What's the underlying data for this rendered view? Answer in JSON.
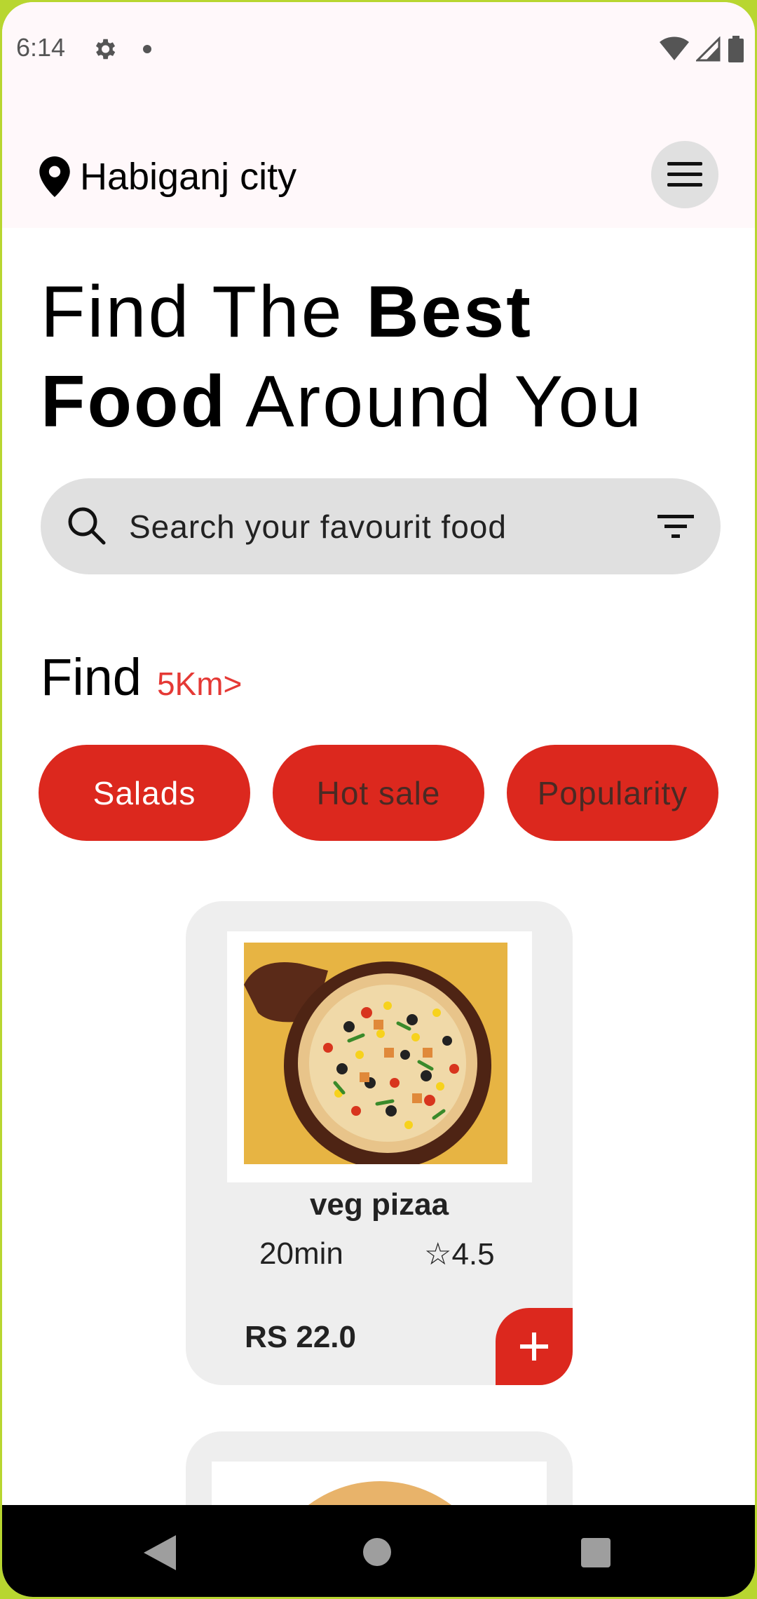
{
  "status_bar": {
    "time": "6:14",
    "icons": [
      "gear-icon",
      "dot-icon",
      "wifi-icon",
      "signal-icon",
      "battery-icon"
    ]
  },
  "header": {
    "location": "Habiganj city",
    "location_icon": "pin-icon",
    "menu_icon": "hamburger-menu-icon"
  },
  "headline": {
    "part1": "Find The ",
    "part2_bold": "Best",
    "part3_bold": "Food",
    "part4": " Around You"
  },
  "search": {
    "placeholder": "Search your favourit food",
    "search_icon": "search-icon",
    "filter_icon": "filter-icon"
  },
  "find": {
    "title": "Find",
    "distance": "5Km>"
  },
  "categories": [
    {
      "label": "Salads",
      "text_color": "#ffffff"
    },
    {
      "label": "Hot sale",
      "text_color": "#4a2a24"
    },
    {
      "label": "Popularity",
      "text_color": "#4a2a24"
    }
  ],
  "food_items": [
    {
      "name": "veg pizaa",
      "time": "20min",
      "rating": "☆4.5",
      "price": "RS 22.0",
      "image": "pizza-image"
    }
  ],
  "nav_bar": {
    "buttons": [
      "back-icon",
      "home-icon",
      "recents-icon"
    ]
  },
  "colors": {
    "accent": "#dc281e",
    "distance_text": "#e53935",
    "chip_bg": "#dc281e",
    "card_bg": "#eeeeee",
    "search_bg": "#e0e0e0"
  }
}
